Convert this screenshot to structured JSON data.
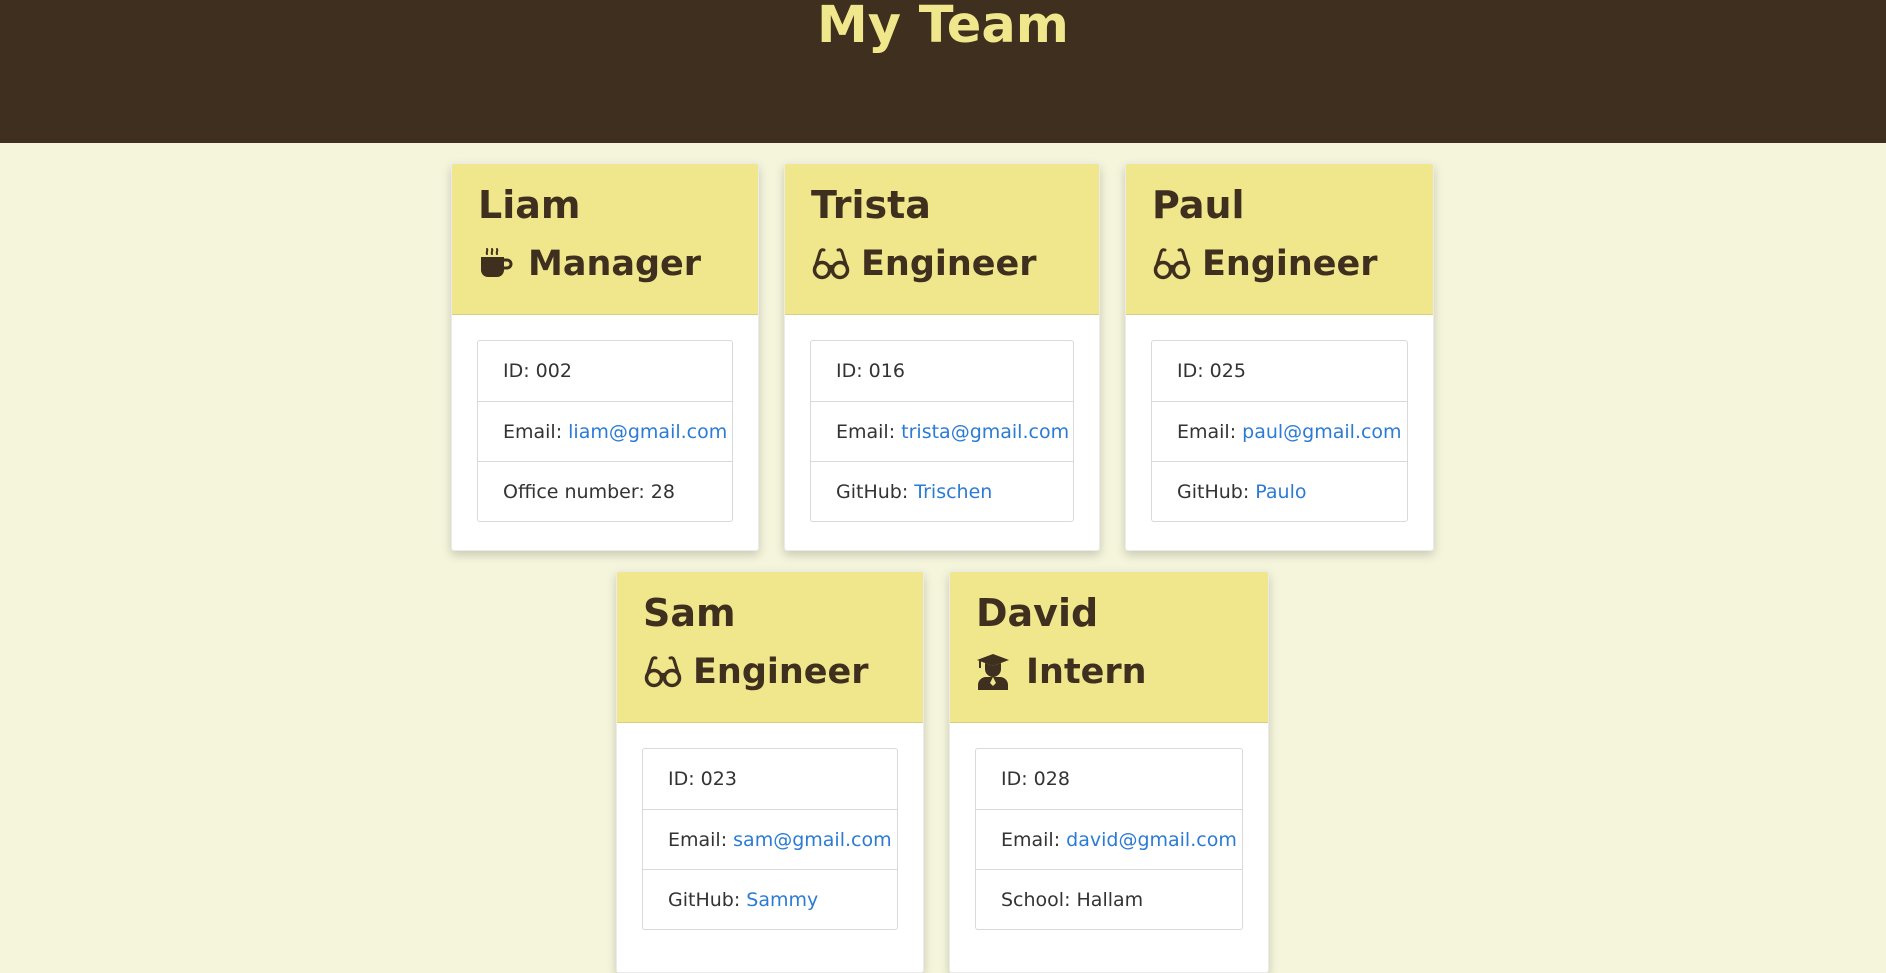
{
  "page": {
    "title": "My Team"
  },
  "colors": {
    "header_bg": "#3e2f1e",
    "title": "#f0e68c",
    "card_header_bg": "#f0e68c",
    "page_bg": "#f5f5dc",
    "link": "#2b7bd6"
  },
  "employees": [
    {
      "name": "Liam",
      "role": "Manager",
      "role_icon": "mug-icon",
      "id_label": "ID: 002",
      "email_label": "Email: ",
      "email": "liam@gmail.com",
      "extra_label": "Office number: 28",
      "extra_link": ""
    },
    {
      "name": "Trista",
      "role": "Engineer",
      "role_icon": "glasses-icon",
      "id_label": "ID: 016",
      "email_label": "Email: ",
      "email": "trista@gmail.com",
      "extra_label": "GitHub: ",
      "extra_link": "Trischen"
    },
    {
      "name": "Paul",
      "role": "Engineer",
      "role_icon": "glasses-icon",
      "id_label": "ID: 025",
      "email_label": "Email: ",
      "email": "paul@gmail.com",
      "extra_label": "GitHub: ",
      "extra_link": "Paulo"
    },
    {
      "name": "Sam",
      "role": "Engineer",
      "role_icon": "glasses-icon",
      "id_label": "ID: 023",
      "email_label": "Email: ",
      "email": "sam@gmail.com",
      "extra_label": "GitHub: ",
      "extra_link": "Sammy"
    },
    {
      "name": "David",
      "role": "Intern",
      "role_icon": "graduate-icon",
      "id_label": "ID: 028",
      "email_label": "Email: ",
      "email": "david@gmail.com",
      "extra_label": "School: Hallam",
      "extra_link": ""
    }
  ]
}
